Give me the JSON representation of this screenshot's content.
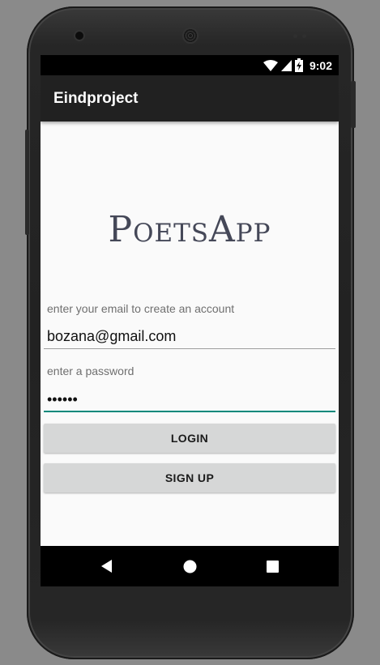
{
  "status_bar": {
    "time": "9:02",
    "icons": [
      "wifi-icon",
      "cell-signal-icon",
      "battery-charging-icon"
    ]
  },
  "app_bar": {
    "title": "Eindproject"
  },
  "logo": {
    "text": "PoetsApp"
  },
  "form": {
    "email_label": "enter your email to create an account",
    "email_value": "bozana@gmail.com",
    "password_label": "enter a password",
    "password_value": "••••••",
    "accent_color": "#00897b"
  },
  "buttons": {
    "login": "LOGIN",
    "signup": "SIGN UP"
  },
  "nav_bar": {
    "icons": [
      "back-icon",
      "home-icon",
      "recents-icon"
    ]
  }
}
